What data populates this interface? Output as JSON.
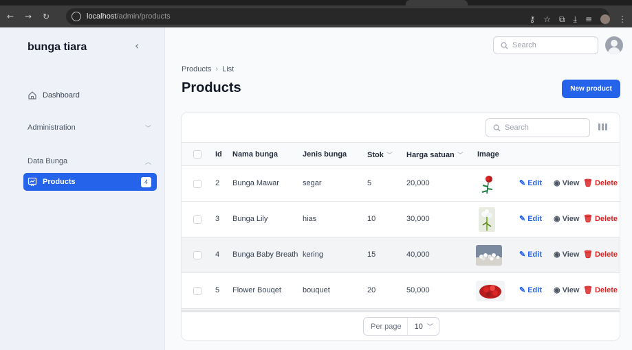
{
  "browser": {
    "url_host": "localhost",
    "url_path": "/admin/products"
  },
  "sidebar": {
    "brand": "bunga tiara",
    "items": [
      {
        "label": "Dashboard"
      }
    ],
    "groups": [
      {
        "label": "Administration"
      },
      {
        "label": "Data Bunga",
        "items": [
          {
            "label": "Products",
            "badge": "4"
          }
        ]
      }
    ]
  },
  "topbar": {
    "search_placeholder": "Search"
  },
  "main": {
    "breadcrumb": [
      "Products",
      "List"
    ],
    "title": "Products",
    "new_button": "New product",
    "table": {
      "search_placeholder": "Search",
      "columns": [
        "Id",
        "Nama bunga",
        "Jenis bunga",
        "Stok",
        "Harga satuan",
        "Image"
      ],
      "rows": [
        {
          "id": "2",
          "nama": "Bunga Mawar",
          "jenis": "segar",
          "stok": "5",
          "harga": "20,000"
        },
        {
          "id": "3",
          "nama": "Bunga Lily",
          "jenis": "hias",
          "stok": "10",
          "harga": "30,000"
        },
        {
          "id": "4",
          "nama": "Bunga Baby Breath",
          "jenis": "kering",
          "stok": "15",
          "harga": "40,000"
        },
        {
          "id": "5",
          "nama": "Flower Bouqet",
          "jenis": "bouquet",
          "stok": "20",
          "harga": "50,000"
        }
      ],
      "actions": {
        "edit": "Edit",
        "view": "View",
        "delete": "Delete"
      },
      "per_page_label": "Per page",
      "per_page_value": "10"
    }
  },
  "colors": {
    "primary": "#2563eb",
    "danger": "#dc2626"
  }
}
